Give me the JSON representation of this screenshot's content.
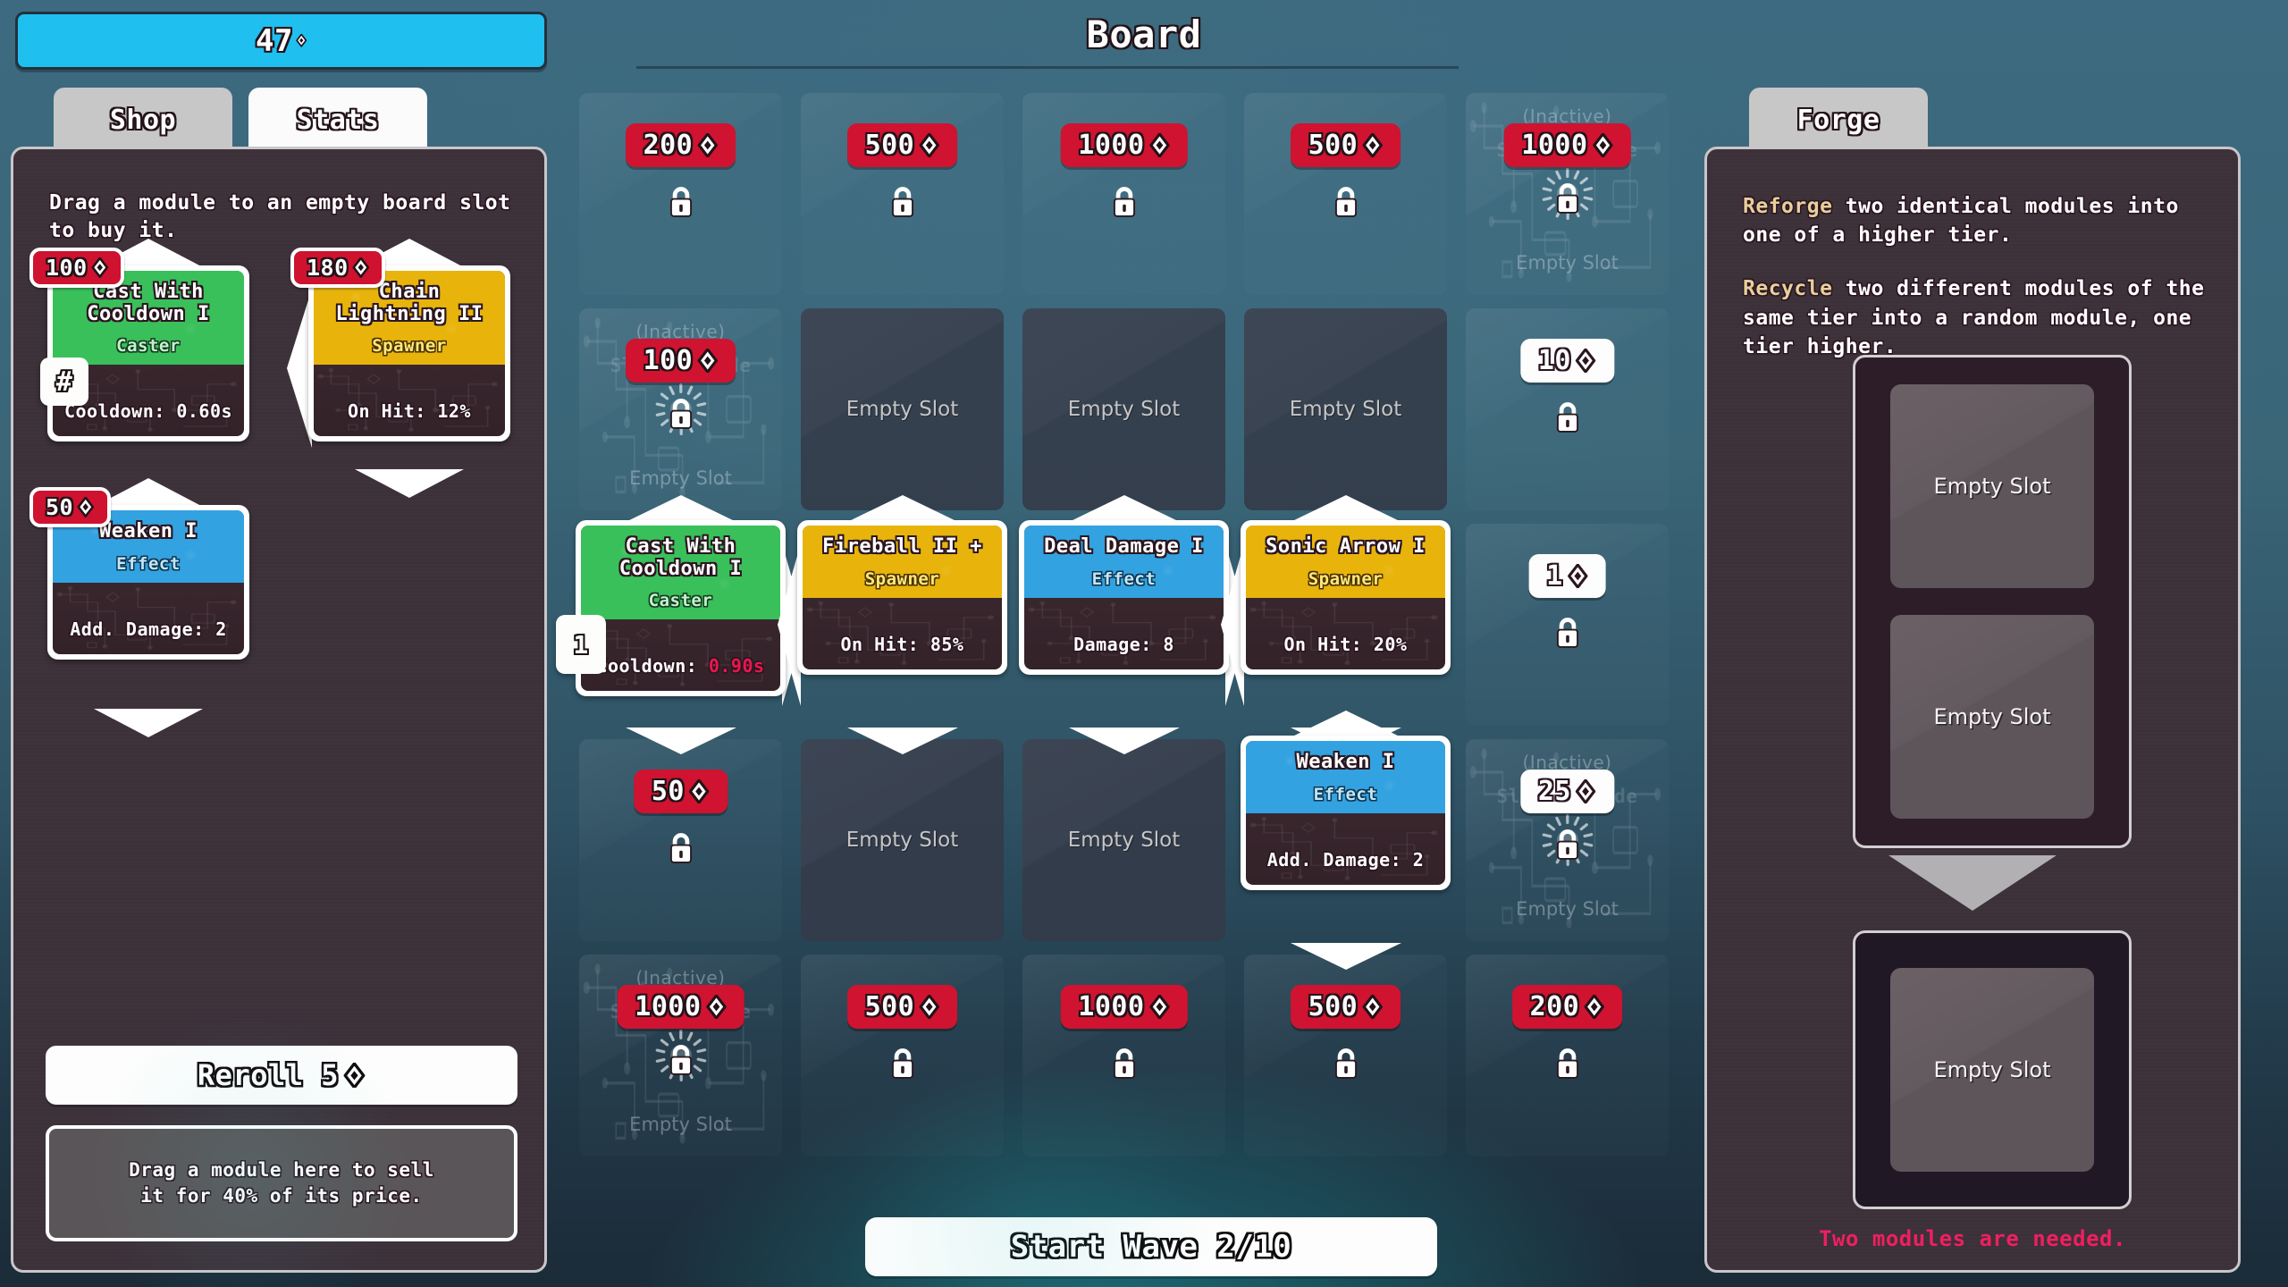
{
  "currency": {
    "amount": "47",
    "icon": "gem-icon"
  },
  "tabs": [
    {
      "label": "Shop",
      "name": "tab-shop",
      "active": false
    },
    {
      "label": "Stats",
      "name": "tab-stats",
      "active": true
    },
    {
      "label": "Forge",
      "name": "tab-forge",
      "active": false
    }
  ],
  "shop": {
    "hint": "Drag a module to an empty board slot to buy it.",
    "reroll_label": "Reroll 5",
    "sell_zone_line1": "Drag a module here to sell",
    "sell_zone_line2": "it for 40% of its price.",
    "cards": [
      {
        "price": "100",
        "title": "Cast With Cooldown I",
        "type": "Caster",
        "color": "green",
        "stat_label": "Cooldown:",
        "stat_value": "0.60s",
        "badge": "#"
      },
      {
        "price": "180",
        "title": "Chain Lightning II",
        "type": "Spawner",
        "color": "yellow",
        "stat_label": "On Hit:",
        "stat_value": "12%",
        "badge": ""
      },
      {
        "price": "50",
        "title": "Weaken I",
        "type": "Effect",
        "color": "blue",
        "stat_label": "Add. Damage:",
        "stat_value": "2",
        "badge": ""
      }
    ]
  },
  "board": {
    "title": "Board",
    "start_wave_label": "Start Wave 2/10",
    "empty_slot_label": "Empty Slot",
    "inactive_label": "(Inactive)",
    "inactive_ghost_title": "Slot Upgrade",
    "cells": [
      {
        "state": "locked",
        "price": "200",
        "price_style": "red"
      },
      {
        "state": "locked",
        "price": "500",
        "price_style": "red"
      },
      {
        "state": "locked",
        "price": "1000",
        "price_style": "red"
      },
      {
        "state": "locked",
        "price": "500",
        "price_style": "red"
      },
      {
        "state": "inactive",
        "price": "1000",
        "price_style": "red"
      },
      {
        "state": "inactive",
        "price": "100",
        "price_style": "red"
      },
      {
        "state": "empty"
      },
      {
        "state": "empty"
      },
      {
        "state": "empty"
      },
      {
        "state": "locked",
        "price": "10",
        "price_style": "white"
      },
      {
        "state": "module",
        "module": {
          "title": "Cast With Cooldown I",
          "type": "Caster",
          "color": "green",
          "stat_label": "Cooldown:",
          "stat_value": "0.90s",
          "stat_highlight": true,
          "index_badge": "1"
        }
      },
      {
        "state": "module",
        "module": {
          "title": "Fireball II +",
          "type": "Spawner",
          "color": "yellow",
          "stat_label": "On Hit:",
          "stat_value": "85%",
          "stat_highlight": false
        }
      },
      {
        "state": "module",
        "module": {
          "title": "Deal Damage I",
          "type": "Effect",
          "color": "blue",
          "stat_label": "Damage:",
          "stat_value": "8",
          "stat_highlight": false
        }
      },
      {
        "state": "module",
        "module": {
          "title": "Sonic Arrow I",
          "type": "Spawner",
          "color": "yellow",
          "stat_label": "On Hit:",
          "stat_value": "20%",
          "stat_highlight": false
        }
      },
      {
        "state": "locked",
        "price": "1",
        "price_style": "white"
      },
      {
        "state": "locked",
        "price": "50",
        "price_style": "red"
      },
      {
        "state": "empty"
      },
      {
        "state": "empty"
      },
      {
        "state": "module",
        "module": {
          "title": "Weaken I",
          "type": "Effect",
          "color": "blue",
          "stat_label": "Add. Damage:",
          "stat_value": "2",
          "stat_highlight": false
        }
      },
      {
        "state": "inactive",
        "price": "25",
        "price_style": "white"
      },
      {
        "state": "inactive",
        "price": "1000",
        "price_style": "red"
      },
      {
        "state": "locked",
        "price": "500",
        "price_style": "red"
      },
      {
        "state": "locked",
        "price": "1000",
        "price_style": "red"
      },
      {
        "state": "locked",
        "price": "500",
        "price_style": "red"
      },
      {
        "state": "locked",
        "price": "200",
        "price_style": "red"
      }
    ]
  },
  "forge": {
    "desc_1_kw": "Reforge",
    "desc_1_rest": " two identical modules into one of a higher tier.",
    "desc_2_kw": "Recycle",
    "desc_2_rest": " two different modules of the same tier into a random module, one tier higher.",
    "slot_label": "Empty Slot",
    "warning": "Two modules are needed."
  },
  "colors": {
    "accent_cyan": "#1fbff0",
    "price_red": "#d01330",
    "warning_pink": "#ef1f60",
    "caster_green": "#39c05a",
    "spawner_yellow": "#e8b40c",
    "effect_blue": "#33a2e0",
    "keyword_tan": "#e8cf9c"
  }
}
